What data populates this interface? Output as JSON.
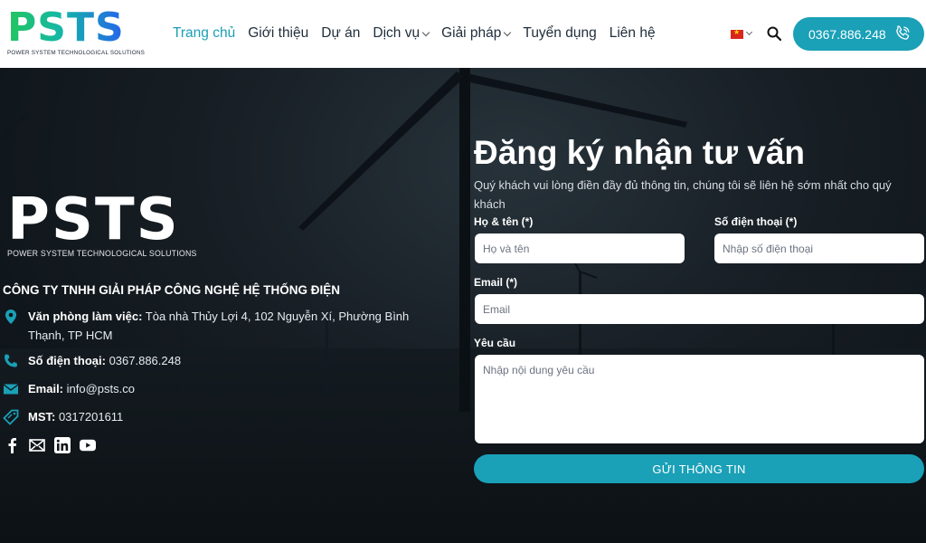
{
  "header": {
    "logo_text": "PSTS",
    "logo_subtext": "POWER SYSTEM TECHNOLOGICAL SOLUTIONS",
    "nav": [
      {
        "label": "Trang chủ",
        "active": true,
        "dropdown": false
      },
      {
        "label": "Giới thiệu",
        "active": false,
        "dropdown": false
      },
      {
        "label": "Dự án",
        "active": false,
        "dropdown": false
      },
      {
        "label": "Dịch vụ",
        "active": false,
        "dropdown": true
      },
      {
        "label": "Giải pháp",
        "active": false,
        "dropdown": true
      },
      {
        "label": "Tuyển dụng",
        "active": false,
        "dropdown": false
      },
      {
        "label": "Liên hệ",
        "active": false,
        "dropdown": false
      }
    ],
    "language_flag": "vietnam-flag-icon",
    "phone": "0367.886.248",
    "accent_color": "#1aa0b7"
  },
  "company": {
    "logo_text": "PSTS",
    "logo_subtext": "POWER SYSTEM TECHNOLOGICAL SOLUTIONS",
    "name": "CÔNG TY TNHH GIẢI PHÁP CÔNG NGHỆ HỆ THỐNG ĐIỆN",
    "office_label": "Văn phòng làm việc:",
    "office_value": " Tòa nhà Thủy Lợi 4, 102 Nguyễn Xí, Phường Bình Thạnh, TP HCM",
    "phone_label": "Số điện thoại:",
    "phone_value": " 0367.886.248",
    "email_label": "Email:",
    "email_value": " info@psts.co",
    "tax_label": "MST:",
    "tax_value": " 0317201611",
    "socials": [
      "facebook-icon",
      "mail-icon",
      "linkedin-icon",
      "youtube-icon"
    ]
  },
  "form": {
    "title": "Đăng ký nhận tư vấn",
    "subtitle": "Quý khách vui lòng điền đầy đủ thông tin, chúng tôi sẽ liên hệ sớm nhất cho quý khách",
    "name_label": "Họ & tên (*)",
    "name_placeholder": "Họ và tên",
    "phone_label": "Số điện thoại (*)",
    "phone_placeholder": "Nhập số điện thoại",
    "email_label": "Email (*)",
    "email_placeholder": "Email",
    "request_label": "Yêu cầu",
    "request_placeholder": "Nhập nội dung yêu cầu",
    "submit_label": "GỬI THÔNG TIN"
  }
}
